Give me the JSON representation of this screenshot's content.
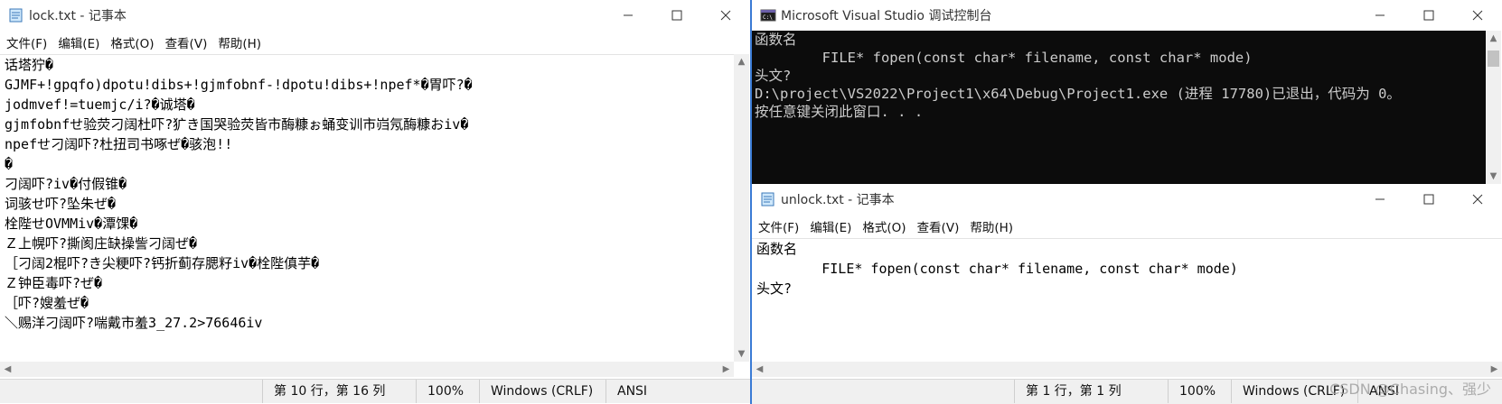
{
  "left_notepad": {
    "title": "lock.txt - 记事本",
    "menu": [
      "文件(F)",
      "编辑(E)",
      "格式(O)",
      "查看(V)",
      "帮助(H)"
    ],
    "lines": [
      "话塔狞�",
      "GJMF+!gpqfo)dpotu!dibs+!gjmfobnf-!dpotu!dibs+!npef*�胃吓?�",
      "jodmvef!=tuemjc/i?�诚塔�",
      "gjmfobnfせ验荧刁阔杜吓?犷き国哭验荧皆市酶糠ぉ蛹变训市岿氖酶糠おiv�",
      "npefせ刁阔吓?杜扭司书啄ぜ�骇泡!!",
      "�",
      "刁阔吓?iv�付假锥�",
      "词骇せ吓?坠朱ぜ�",
      "栓陛せOVMMiv�潭馃�",
      "Ｚ上幌吓?撕阂庄缺操訾刁阔ぜ�",
      "［刁阔2棍吓?き尖粳吓?钙折蓟存腮籽iv�栓陛傎芋�",
      "Ｚ钟臣毒吓?ぜ�",
      "［吓?嫂羞ぜ�",
      "＼赐洋刁阔吓?喘戴市羞3_27.2>76646iv"
    ],
    "status": {
      "position": "第 10 行，第 16 列",
      "zoom": "100%",
      "line_ending": "Windows (CRLF)",
      "encoding": "ANSI"
    }
  },
  "console": {
    "title": "Microsoft Visual Studio 调试控制台",
    "lines": [
      "函数名",
      "        FILE* fopen(const char* filename, const char* mode)",
      "头文?",
      "D:\\project\\VS2022\\Project1\\x64\\Debug\\Project1.exe (进程 17780)已退出，代码为 0。",
      "按任意键关闭此窗口. . ."
    ]
  },
  "right_notepad": {
    "title": "unlock.txt - 记事本",
    "menu": [
      "文件(F)",
      "编辑(E)",
      "格式(O)",
      "查看(V)",
      "帮助(H)"
    ],
    "lines": [
      "函数名",
      "        FILE* fopen(const char* filename, const char* mode)",
      "头文?"
    ],
    "status": {
      "position": "第 1 行，第 1 列",
      "zoom": "100%",
      "line_ending": "Windows (CRLF)",
      "encoding": "ANSI"
    }
  },
  "watermark": "CSDN @Chasing、强少",
  "colors": {
    "console_bg": "#0c0c0c",
    "console_text": "#cccccc",
    "window_bg": "#ffffff",
    "status_bg": "#f0f0f0",
    "divider": "#3a7bd5"
  },
  "icons": {
    "notepad": "notepad-icon",
    "console": "console-icon",
    "minimize": "minimize-icon",
    "maximize": "maximize-icon",
    "close": "close-icon"
  }
}
